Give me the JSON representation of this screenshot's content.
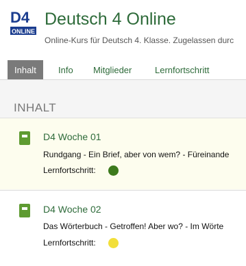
{
  "header": {
    "logo_text_top": "D4",
    "logo_text_bottom": "ONLINE",
    "title": "Deutsch 4 Online",
    "subtitle": "Online-Kurs für Deutsch 4. Klasse. Zugelassen durc"
  },
  "tabs": [
    {
      "label": "Inhalt",
      "active": true
    },
    {
      "label": "Info",
      "active": false
    },
    {
      "label": "Mitglieder",
      "active": false
    },
    {
      "label": "Lernfortschritt",
      "active": false
    }
  ],
  "section": {
    "title": "INHALT"
  },
  "units": [
    {
      "title": "D4 Woche 01",
      "description": "Rundgang - Ein Brief, aber von wem? - Füreinande",
      "progress_label": "Lernfortschritt:",
      "progress_color": "#3d7a1c"
    },
    {
      "title": "D4 Woche 02",
      "description": "Das Wörterbuch - Getroffen! Aber wo? - Im Wörte",
      "progress_label": "Lernfortschritt:",
      "progress_color": "#f2df3a"
    }
  ],
  "colors": {
    "accent": "#2e6b3a",
    "book_icon": "#5e9b31",
    "active_tab": "#7a7a7a"
  }
}
